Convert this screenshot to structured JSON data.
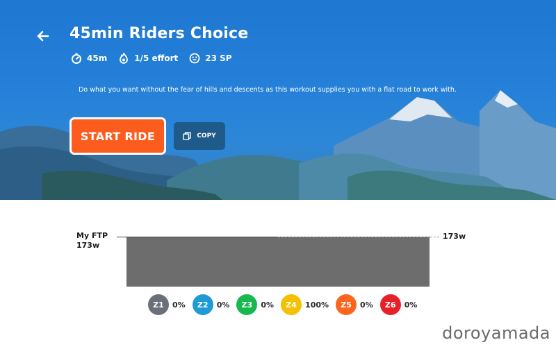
{
  "workout": {
    "title": "45min Riders Choice",
    "duration": "45m",
    "effort": "1/5 effort",
    "sp": "23 SP",
    "description": "Do what you want without the fear of hills and descents as this workout supplies you with a flat road to work with."
  },
  "actions": {
    "start_label": "START RIDE",
    "copy_label": "COPY"
  },
  "ftp": {
    "label": "My FTP",
    "value": "173w",
    "right_value": "173w"
  },
  "zones": [
    {
      "name": "Z1",
      "pct": "0%",
      "color": "#6b6f7a"
    },
    {
      "name": "Z2",
      "pct": "0%",
      "color": "#1e9ad6"
    },
    {
      "name": "Z3",
      "pct": "0%",
      "color": "#17b84e"
    },
    {
      "name": "Z4",
      "pct": "100%",
      "color": "#f5c000"
    },
    {
      "name": "Z5",
      "pct": "0%",
      "color": "#fb6520"
    },
    {
      "name": "Z6",
      "pct": "0%",
      "color": "#e8202a"
    }
  ],
  "icons": {
    "back": "back-arrow-icon",
    "duration": "stopwatch-icon",
    "effort": "flame-icon",
    "sp": "smile-icon",
    "copy": "copy-icon"
  },
  "colors": {
    "accent": "#fc5d1e",
    "copy_button": "#1f5b8a",
    "block": "#6d6d6d"
  },
  "watermark": "doroyamada"
}
